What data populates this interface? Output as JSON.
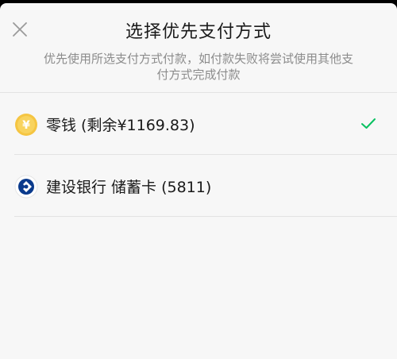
{
  "header": {
    "title": "选择优先支付方式",
    "subtitle": "优先使用所选支付方式付款，如付款失败将尝试使用其他支付方式完成付款"
  },
  "options": [
    {
      "label": "零钱 (剩余¥1169.83)",
      "icon": "wallet-coin-icon",
      "icon_glyph": "¥",
      "selected": true
    },
    {
      "label": "建设银行 储蓄卡 (5811)",
      "icon": "ccb-bank-logo-icon",
      "selected": false
    }
  ],
  "colors": {
    "sheet_background": "#f7f7f7",
    "check_green": "#07c160",
    "coin_yellow": "#f5c542",
    "bank_blue": "#0a3a8c"
  }
}
